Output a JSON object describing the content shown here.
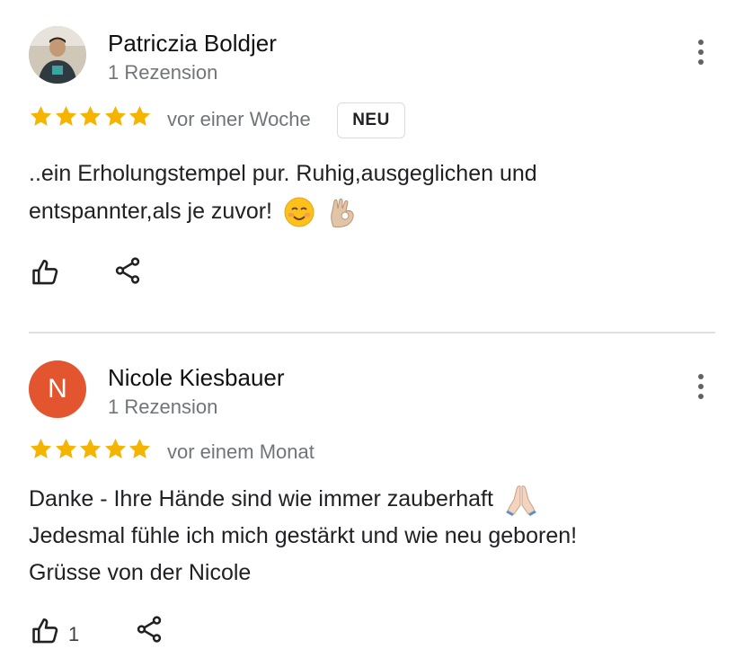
{
  "reviews": [
    {
      "author": "Patriczia Boldjer",
      "meta": "1 Rezension",
      "avatar_letter": "",
      "rating": 5,
      "time": "vor einer Woche",
      "badge": "NEU",
      "text_lines": [
        "..ein Erholungstempel pur. Ruhig,ausgeglichen und",
        "entspannter,als je zuvor!"
      ],
      "emojis": [
        "smiling-face-emoji",
        "ok-hand-emoji"
      ],
      "like_count": ""
    },
    {
      "author": "Nicole Kiesbauer",
      "meta": "1 Rezension",
      "avatar_letter": "N",
      "avatar_color": "#e2552e",
      "rating": 5,
      "time": "vor einem Monat",
      "text_lines": [
        "Danke - Ihre Hände sind wie immer zauberhaft",
        "Jedesmal fühle ich mich gestärkt und wie neu geboren!",
        "Grüsse von der Nicole"
      ],
      "emojis": [
        "folded-hands-emoji"
      ],
      "like_count": "1"
    }
  ],
  "colors": {
    "star": "#f4b400",
    "meta": "#70757a",
    "divider": "#e0e0e0"
  },
  "icons": [
    "thumb-up-icon",
    "share-icon",
    "more-vert-icon",
    "star-icon"
  ]
}
